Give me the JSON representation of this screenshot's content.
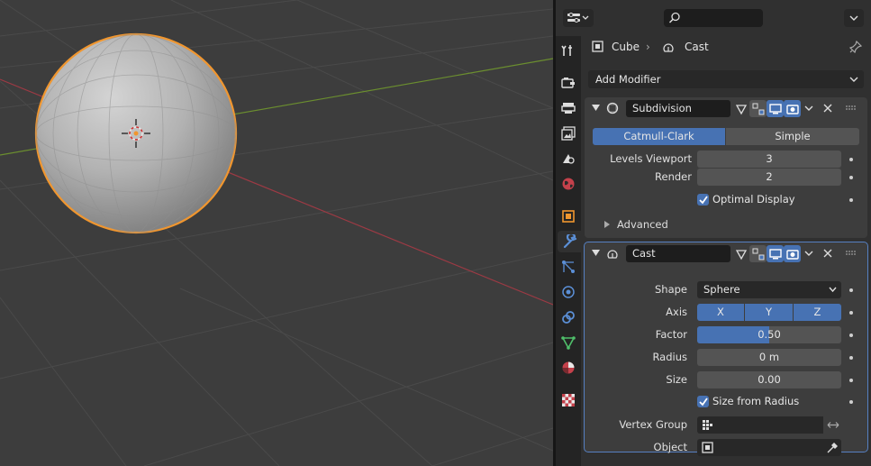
{
  "header": {
    "search_placeholder": ""
  },
  "breadcrumb": {
    "object": "Cube",
    "modifier": "Cast"
  },
  "add_modifier_label": "Add Modifier",
  "subdivision": {
    "name": "Subdivision",
    "tab_catmull": "Catmull-Clark",
    "tab_simple": "Simple",
    "levels_viewport_label": "Levels Viewport",
    "levels_viewport_value": "3",
    "render_label": "Render",
    "render_value": "2",
    "optimal_display_label": "Optimal Display",
    "advanced_label": "Advanced"
  },
  "cast": {
    "name": "Cast",
    "shape_label": "Shape",
    "shape_value": "Sphere",
    "axis_label": "Axis",
    "axis_x": "X",
    "axis_y": "Y",
    "axis_z": "Z",
    "factor_label": "Factor",
    "factor_value": "0.50",
    "factor_fill": 0.5,
    "radius_label": "Radius",
    "radius_value": "0 m",
    "size_label": "Size",
    "size_value": "0.00",
    "size_from_radius_label": "Size from Radius",
    "vertex_group_label": "Vertex Group",
    "object_label": "Object"
  },
  "colors": {
    "accent": "#4772b3",
    "selection_outline": "#f0962f",
    "x_axis": "#9c3a44",
    "y_axis": "#6b8e2f"
  }
}
